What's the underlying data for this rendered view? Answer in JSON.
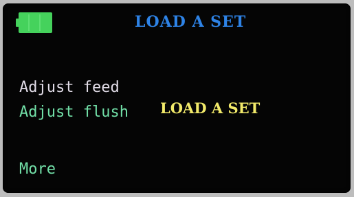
{
  "header": {
    "battery_icon": "battery-full-icon",
    "battery_color": "#45d25c",
    "title": "LOAD A SET",
    "title_color": "#2e83e6"
  },
  "menu": {
    "items": [
      {
        "label": "Adjust feed",
        "color": "#e2dde8"
      },
      {
        "label": "Adjust flush",
        "color": "#72e0a8"
      },
      {
        "label": "More",
        "color": "#72e0a8"
      }
    ]
  },
  "overlay": {
    "title": "LOAD A SET",
    "color": "#f2ea6a"
  },
  "screen": {
    "background": "#050505"
  }
}
